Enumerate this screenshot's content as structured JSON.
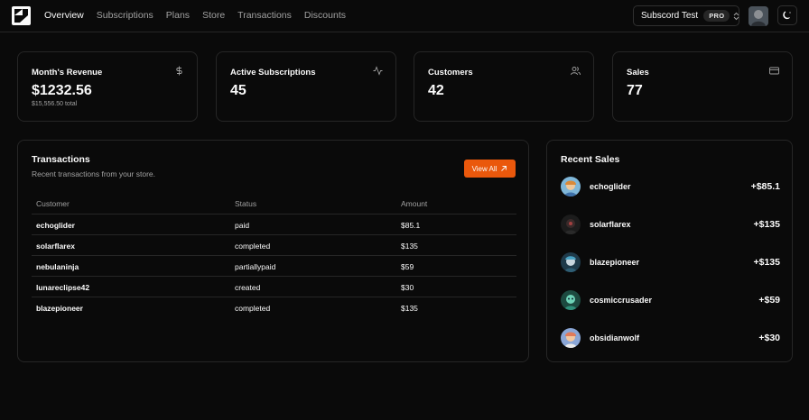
{
  "nav": {
    "items": [
      {
        "label": "Overview",
        "active": true
      },
      {
        "label": "Subscriptions",
        "active": false
      },
      {
        "label": "Plans",
        "active": false
      },
      {
        "label": "Store",
        "active": false
      },
      {
        "label": "Transactions",
        "active": false
      },
      {
        "label": "Discounts",
        "active": false
      }
    ],
    "store_name": "Subscord Test",
    "plan_badge": "PRO"
  },
  "stats": [
    {
      "title": "Month's Revenue",
      "value": "$1232.56",
      "sub": "$15,556.50 total",
      "icon": "dollar-icon"
    },
    {
      "title": "Active Subscriptions",
      "value": "45",
      "sub": "",
      "icon": "activity-icon"
    },
    {
      "title": "Customers",
      "value": "42",
      "sub": "",
      "icon": "users-icon"
    },
    {
      "title": "Sales",
      "value": "77",
      "sub": "",
      "icon": "credit-card-icon"
    }
  ],
  "transactions": {
    "title": "Transactions",
    "description": "Recent transactions from your store.",
    "view_all_label": "View All",
    "columns": [
      "Customer",
      "Status",
      "Amount"
    ],
    "rows": [
      {
        "customer": "echoglider",
        "status": "paid",
        "amount": "$85.1"
      },
      {
        "customer": "solarflarex",
        "status": "completed",
        "amount": "$135"
      },
      {
        "customer": "nebulaninja",
        "status": "partiallypaid",
        "amount": "$59"
      },
      {
        "customer": "lunareclipse42",
        "status": "created",
        "amount": "$30"
      },
      {
        "customer": "blazepioneer",
        "status": "completed",
        "amount": "$135"
      }
    ]
  },
  "recent_sales": {
    "title": "Recent Sales",
    "items": [
      {
        "name": "echoglider",
        "amount": "+$85.1",
        "avatar_color": "#7fb7d9"
      },
      {
        "name": "solarflarex",
        "amount": "+$135",
        "avatar_color": "#1c1c1c"
      },
      {
        "name": "blazepioneer",
        "amount": "+$135",
        "avatar_color": "#2e5d73"
      },
      {
        "name": "cosmiccrusader",
        "amount": "+$59",
        "avatar_color": "#2f8f7a"
      },
      {
        "name": "obsidianwolf",
        "amount": "+$30",
        "avatar_color": "#8aa6d6"
      }
    ]
  },
  "colors": {
    "accent": "#ea580c",
    "background": "#0a0a0a",
    "border": "#262626",
    "muted_text": "#a1a1a1"
  }
}
